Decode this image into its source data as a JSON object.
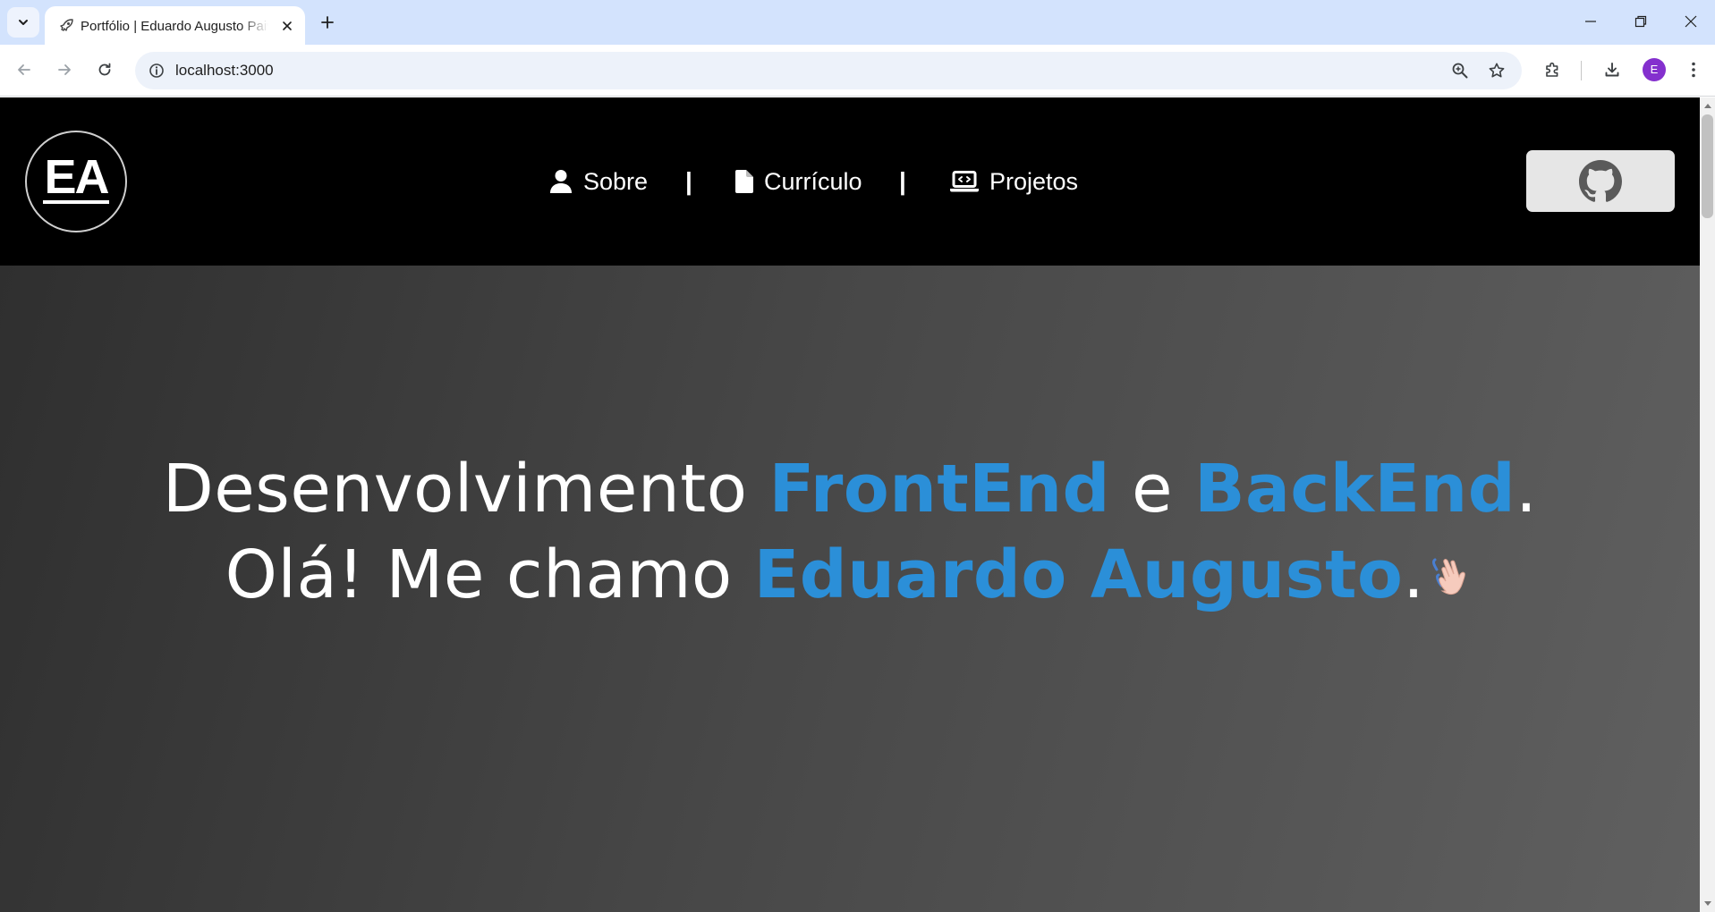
{
  "browser": {
    "tab": {
      "title": "Portfólio | Eduardo Augusto Paiva"
    },
    "address": {
      "url": "localhost:3000"
    },
    "profile_initial": "E"
  },
  "site": {
    "logo_text": "EA",
    "nav": [
      {
        "label": "Sobre",
        "icon": "user-icon"
      },
      {
        "label": "Currículo",
        "icon": "document-icon"
      },
      {
        "label": "Projetos",
        "icon": "laptop-code-icon"
      }
    ],
    "nav_separator": "|",
    "github_icon": "github-icon"
  },
  "hero": {
    "line1": {
      "prefix": "Desenvolvimento ",
      "accent1": "FrontEnd",
      "middle": " e ",
      "accent2": "BackEnd",
      "suffix": "."
    },
    "line2": {
      "prefix": "Olá! Me chamo ",
      "accent": "Eduardo Augusto",
      "suffix": "."
    },
    "emoji": "waving-hand-icon"
  },
  "colors": {
    "accent": "#2b8fd8",
    "header_bg": "#000000",
    "hero_bg_start": "#2f2f2f",
    "hero_bg_end": "#606060",
    "github_button_bg": "#e6e6e6"
  }
}
